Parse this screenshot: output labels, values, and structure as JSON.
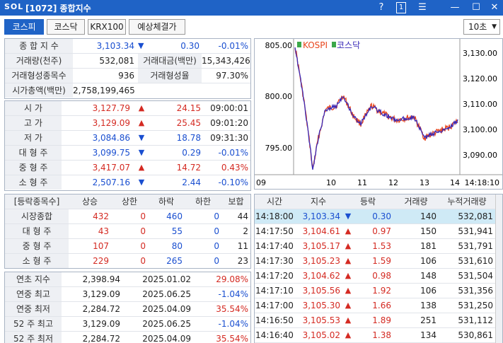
{
  "window": {
    "logo": "SOL",
    "title": "[1072] 종합지수",
    "btn_help": "?",
    "btn_one": "1",
    "btn_menu": "☰",
    "btn_min": "—",
    "btn_max": "☐",
    "btn_close": "✕"
  },
  "tabs": [
    {
      "label": "코스피"
    },
    {
      "label": "코스닥"
    },
    {
      "label": "KRX100"
    },
    {
      "label": "예상체결가"
    }
  ],
  "interval": {
    "value": "10초",
    "caret": "▼"
  },
  "summary": {
    "index_label": "종 합 지 수",
    "index_value": "3,103.34",
    "index_arrow": "▼",
    "index_change": "0.30",
    "index_pct": "-0.01%",
    "volume_label": "거래량(천주)",
    "volume_value": "532,081",
    "amount_label": "거래대금(백만)",
    "amount_value": "15,343,426",
    "formed_label": "거래형성종목수",
    "formed_value": "936",
    "formed_rate_label": "거래형성율",
    "formed_rate_value": "97.30%",
    "mcap_label": "시가총액(백만)",
    "mcap_value": "2,758,199,465"
  },
  "ohlc": [
    {
      "label": "시      가",
      "value": "3,127.79",
      "color": "red",
      "arrow": "▲",
      "change": "24.15",
      "time": "09:00:01"
    },
    {
      "label": "고      가",
      "value": "3,129.09",
      "color": "red",
      "arrow": "▲",
      "change": "25.45",
      "time": "09:01:20"
    },
    {
      "label": "저      가",
      "value": "3,084.86",
      "color": "blue",
      "arrow": "▼",
      "change": "18.78",
      "time": "09:31:30"
    },
    {
      "label": "대 형 주",
      "value": "3,099.75",
      "color": "blue",
      "arrow": "▼",
      "change": "0.29",
      "time": "-0.01%"
    },
    {
      "label": "중 형 주",
      "value": "3,417.07",
      "color": "red",
      "arrow": "▲",
      "change": "14.72",
      "time": "0.43%"
    },
    {
      "label": "소 형 주",
      "value": "2,507.16",
      "color": "blue",
      "arrow": "▼",
      "change": "2.44",
      "time": "-0.10%"
    }
  ],
  "breadth": {
    "headers": [
      "[등락종목수]",
      "상승",
      "상한",
      "하락",
      "하한",
      "보합"
    ],
    "rows": [
      {
        "label": "시장종합",
        "up": "432",
        "upper": "0",
        "down": "460",
        "lower": "0",
        "flat": "44"
      },
      {
        "label": "대 형 주",
        "up": "43",
        "upper": "0",
        "down": "55",
        "lower": "0",
        "flat": "2"
      },
      {
        "label": "중 형 주",
        "up": "107",
        "upper": "0",
        "down": "80",
        "lower": "0",
        "flat": "11"
      },
      {
        "label": "소 형 주",
        "up": "229",
        "upper": "0",
        "down": "265",
        "lower": "0",
        "flat": "23"
      }
    ]
  },
  "yearly": [
    {
      "label": "연초  지수",
      "value": "2,398.94",
      "date": "2025.01.02",
      "pct": "29.08%",
      "color": "red"
    },
    {
      "label": "연중  최고",
      "value": "3,129.09",
      "date": "2025.06.25",
      "pct": "-1.04%",
      "color": "blue"
    },
    {
      "label": "연중  최저",
      "value": "2,284.72",
      "date": "2025.04.09",
      "pct": "35.54%",
      "color": "red"
    },
    {
      "label": "52 주 최고",
      "value": "3,129.09",
      "date": "2025.06.25",
      "pct": "-1.04%",
      "color": "blue"
    },
    {
      "label": "52 주 최저",
      "value": "2,284.72",
      "date": "2025.04.09",
      "pct": "35.54%",
      "color": "red"
    }
  ],
  "ticks": {
    "headers": [
      "시간",
      "지수",
      "등락",
      "거래량",
      "누적거래량"
    ],
    "rows": [
      {
        "time": "14:18:00",
        "index": "3,103.34",
        "arrow": "▼",
        "change": "0.30",
        "vol": "140",
        "cum": "532,081",
        "color": "blue"
      },
      {
        "time": "14:17:50",
        "index": "3,104.61",
        "arrow": "▲",
        "change": "0.97",
        "vol": "150",
        "cum": "531,941",
        "color": "red"
      },
      {
        "time": "14:17:40",
        "index": "3,105.17",
        "arrow": "▲",
        "change": "1.53",
        "vol": "181",
        "cum": "531,791",
        "color": "red"
      },
      {
        "time": "14:17:30",
        "index": "3,105.23",
        "arrow": "▲",
        "change": "1.59",
        "vol": "106",
        "cum": "531,610",
        "color": "red"
      },
      {
        "time": "14:17:20",
        "index": "3,104.62",
        "arrow": "▲",
        "change": "0.98",
        "vol": "148",
        "cum": "531,504",
        "color": "red"
      },
      {
        "time": "14:17:10",
        "index": "3,105.56",
        "arrow": "▲",
        "change": "1.92",
        "vol": "106",
        "cum": "531,356",
        "color": "red"
      },
      {
        "time": "14:17:00",
        "index": "3,105.30",
        "arrow": "▲",
        "change": "1.66",
        "vol": "138",
        "cum": "531,250",
        "color": "red"
      },
      {
        "time": "14:16:50",
        "index": "3,105.53",
        "arrow": "▲",
        "change": "1.89",
        "vol": "251",
        "cum": "531,112",
        "color": "red"
      },
      {
        "time": "14:16:40",
        "index": "3,105.02",
        "arrow": "▲",
        "change": "1.38",
        "vol": "134",
        "cum": "530,861",
        "color": "red"
      }
    ]
  },
  "chart": {
    "legend_kospi": "KOSPI",
    "legend_kosdaq": "코스닥",
    "left_ticks": [
      "805.00",
      "800.00",
      "795.00"
    ],
    "right_ticks": [
      "3,130.00",
      "3,120.00",
      "3,110.00",
      "3,100.00",
      "3,090.00"
    ],
    "x_ticks": [
      "09",
      "10",
      "11",
      "12",
      "13",
      "14"
    ],
    "x_end": "14:18:10",
    "kospi_color": "#e8451c",
    "kosdaq_color": "#3a2ab8"
  },
  "colors": {
    "accent": "#1f63c6",
    "up": "#d42a22",
    "down": "#1a4fd0"
  }
}
